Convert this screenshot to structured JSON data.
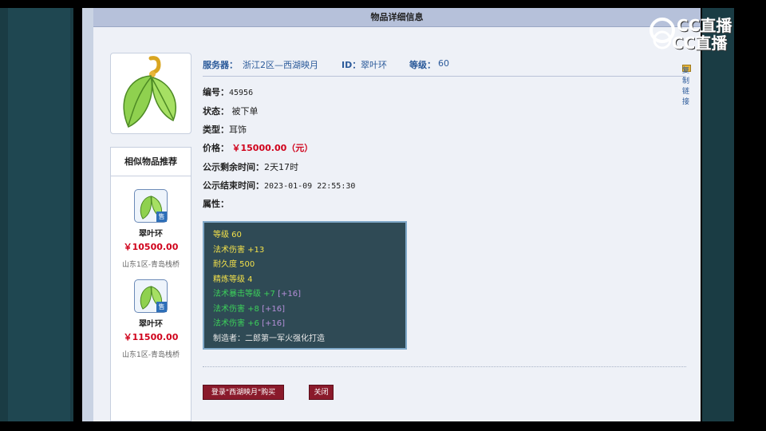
{
  "header": {
    "title": "物品详细信息"
  },
  "item": {
    "server_label": "服务器：",
    "server_value": "浙江2区—西湖映月",
    "id_label": "ID：",
    "id_value": "翠叶环",
    "level_label": "等级：",
    "level_value": "60",
    "copy_link": "复制链接",
    "number_label": "编号：",
    "number_value": "45956",
    "status_label": "状态：",
    "status_value": "被下单",
    "type_label": "类型：",
    "type_value": "耳饰",
    "price_label": "价格：",
    "price_value": "￥15000.00（元）",
    "remaining_label": "公示剩余时间：",
    "remaining_value": "2天17时",
    "end_label": "公示结束时间：",
    "end_value": "2023-01-09 22:55:30",
    "attr_label": "属性："
  },
  "attributes": [
    {
      "text": "等级 60",
      "extra": "",
      "color": "yellow"
    },
    {
      "text": "法术伤害 +13",
      "extra": "",
      "color": "yellow"
    },
    {
      "text": "耐久度 500",
      "extra": "",
      "color": "yellow"
    },
    {
      "text": "精炼等级 4",
      "extra": "",
      "color": "yellow"
    },
    {
      "text": "法术暴击等级 +7",
      "extra": "[+16]",
      "color": "green"
    },
    {
      "text": "法术伤害 +8",
      "extra": "[+16]",
      "color": "green"
    },
    {
      "text": "法术伤害 +6",
      "extra": "[+16]",
      "color": "green"
    },
    {
      "text": "制造者：二郎第一军火强化打造",
      "extra": "",
      "color": "white"
    }
  ],
  "sidebar": {
    "title": "相似物品推荐",
    "items": [
      {
        "name": "翠叶环",
        "price": "￥10500.00",
        "server": "山东1区-青岛栈桥",
        "badge": "售"
      },
      {
        "name": "翠叶环",
        "price": "￥11500.00",
        "server": "山东1区-青岛栈桥",
        "badge": "售"
      }
    ]
  },
  "buttons": {
    "login_buy": "登录\"西湖映月\"购买",
    "close": "关闭"
  },
  "watermark": {
    "text": "CC直播"
  },
  "colors": {
    "price_red": "#d0021b",
    "label_blue": "#2b5a9a",
    "button_maroon": "#8a1a2b",
    "attr_bg": "#2f4a55"
  }
}
